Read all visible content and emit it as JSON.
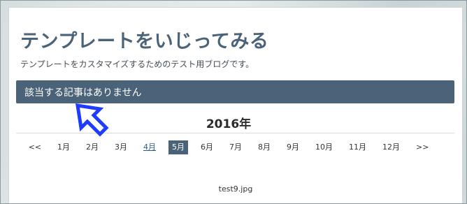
{
  "header": {
    "site_title": "テンプレートをいじってみる",
    "site_description": "テンプレートをカスタマイズするためのテスト用ブログです。"
  },
  "notice": {
    "text": "該当する記事はありません"
  },
  "annotation": {
    "icon": "arrow-pointer-icon",
    "color": "#1e3cff"
  },
  "archive": {
    "year_heading": "2016年",
    "prev_label": "<<",
    "next_label": ">>",
    "months": [
      "1月",
      "2月",
      "3月",
      "4月",
      "5月",
      "6月",
      "7月",
      "8月",
      "9月",
      "10月",
      "11月",
      "12月"
    ],
    "linked_month": "4月",
    "current_month": "5月"
  },
  "footer": {
    "image_caption": "test9.jpg"
  },
  "colors": {
    "accent": "#4a6378",
    "link": "#2c5a8a"
  }
}
